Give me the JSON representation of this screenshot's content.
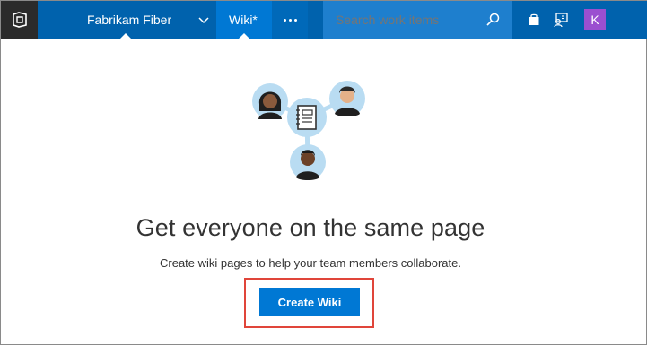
{
  "header": {
    "project_name": "Fabrikam Fiber",
    "active_tab": "Wiki*",
    "search_placeholder": "Search work items",
    "avatar_initial": "K",
    "colors": {
      "bar": "#0062ad",
      "active_tab": "#0078d4",
      "search": "#1e7fce",
      "avatar": "#9b4fd0"
    },
    "icons": [
      "vsts-logo-icon",
      "chevron-down-icon",
      "more-icon",
      "search-icon",
      "marketplace-bag-icon",
      "feedback-icon"
    ]
  },
  "main": {
    "headline": "Get everyone on the same page",
    "subtext": "Create wiki pages to help your team members collaborate.",
    "create_button": "Create Wiki",
    "highlight_color": "#e0453a"
  }
}
